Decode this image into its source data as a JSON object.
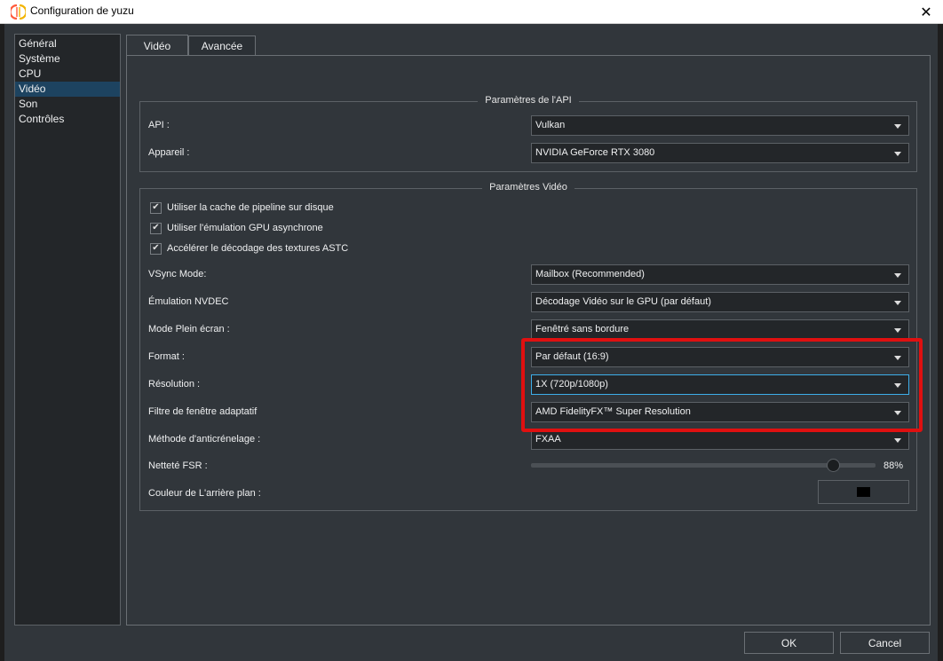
{
  "window": {
    "title": "Configuration de yuzu",
    "close": "✕"
  },
  "sidebar": {
    "items": [
      {
        "label": "Général"
      },
      {
        "label": "Système"
      },
      {
        "label": "CPU"
      },
      {
        "label": "Vidéo"
      },
      {
        "label": "Son"
      },
      {
        "label": "Contrôles"
      }
    ],
    "selected": "Vidéo"
  },
  "tabs": [
    {
      "label": "Vidéo"
    },
    {
      "label": "Avancée"
    }
  ],
  "api_group": {
    "title": "Paramètres de l'API",
    "api_label": "API :",
    "api_value": "Vulkan",
    "device_label": "Appareil :",
    "device_value": "NVIDIA GeForce RTX 3080"
  },
  "video_group": {
    "title": "Paramètres Vidéo",
    "checkboxes": [
      {
        "label": "Utiliser la cache de pipeline sur disque",
        "checked": true
      },
      {
        "label": "Utiliser l'émulation GPU asynchrone",
        "checked": true
      },
      {
        "label": "Accélérer le décodage des textures ASTC",
        "checked": true
      }
    ],
    "vsync_label": "VSync Mode:",
    "vsync_value": "Mailbox (Recommended)",
    "nvdec_label": "Émulation NVDEC",
    "nvdec_value": "Décodage Vidéo sur le GPU (par défaut)",
    "fullscreen_label": "Mode Plein écran :",
    "fullscreen_value": "Fenêtré sans bordure",
    "format_label": "Format :",
    "format_value": "Par défaut (16:9)",
    "resolution_label": "Résolution :",
    "resolution_value": "1X (720p/1080p)",
    "filter_label": "Filtre de fenêtre adaptatif",
    "filter_value": "AMD FidelityFX™ Super Resolution",
    "aa_label": "Méthode d'anticrénelage :",
    "aa_value": "FXAA",
    "fsr_label": "Netteté FSR :",
    "fsr_value": "88%",
    "fsr_fraction": 0.88,
    "bg_label": "Couleur de L'arrière plan :",
    "bg_color": "#000000"
  },
  "buttons": {
    "ok": "OK",
    "cancel": "Cancel"
  },
  "colors": {
    "highlight": "#e01010",
    "selection": "#1d4360",
    "focus": "#3daee9"
  }
}
